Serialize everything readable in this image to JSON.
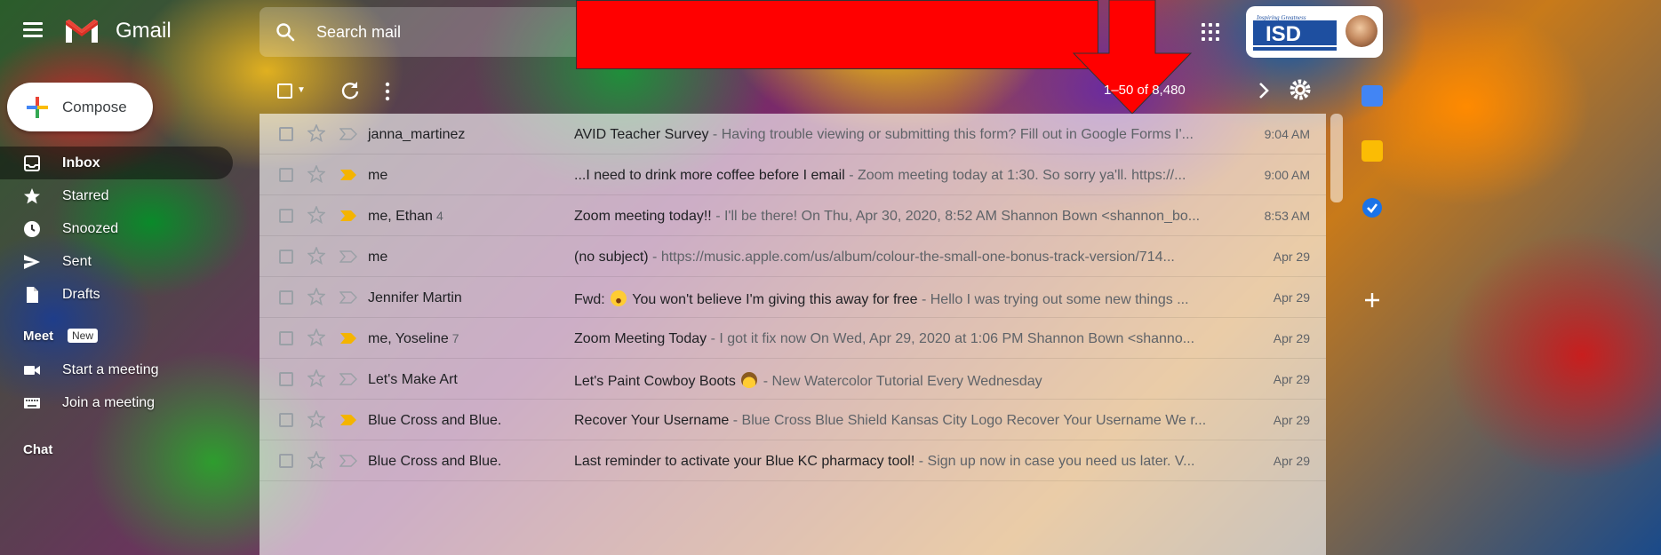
{
  "app": {
    "brand": "Gmail"
  },
  "search": {
    "placeholder": "Search mail"
  },
  "toolbar": {
    "pager": "1–50 of 8,480"
  },
  "compose": {
    "label": "Compose"
  },
  "nav": {
    "items": [
      {
        "label": "Inbox",
        "icon": "inbox-icon"
      },
      {
        "label": "Starred",
        "icon": "star-icon"
      },
      {
        "label": "Snoozed",
        "icon": "clock-icon"
      },
      {
        "label": "Sent",
        "icon": "send-icon"
      },
      {
        "label": "Drafts",
        "icon": "draft-icon"
      }
    ]
  },
  "meet": {
    "header": "Meet",
    "badge": "New",
    "items": [
      {
        "label": "Start a meeting",
        "icon": "video-icon"
      },
      {
        "label": "Join a meeting",
        "icon": "keyboard-icon"
      }
    ]
  },
  "chat": {
    "header": "Chat"
  },
  "emails": [
    {
      "sender": "janna_martinez",
      "count": "",
      "subject": "AVID Teacher Survey",
      "snippet": " - Having trouble viewing or submitting this form? Fill out in Google Forms I'...",
      "time": "9:04 AM",
      "important": false
    },
    {
      "sender": "me",
      "count": "",
      "subject": "...I need to drink more coffee before I email",
      "snippet": " - Zoom meeting today at 1:30. So sorry ya'll. https://...",
      "time": "9:00 AM",
      "important": true
    },
    {
      "sender": "me, Ethan",
      "count": "4",
      "subject": "Zoom meeting today!!",
      "snippet": " - I'll be there! On Thu, Apr 30, 2020, 8:52 AM Shannon Bown <shannon_bo...",
      "time": "8:53 AM",
      "important": true
    },
    {
      "sender": "me",
      "count": "",
      "subject": "(no subject)",
      "snippet": " - https://music.apple.com/us/album/colour-the-small-one-bonus-track-version/714...",
      "time": "Apr 29",
      "important": false
    },
    {
      "sender": "Jennifer Martin",
      "count": "",
      "subject_pre": "Fwd: ",
      "subject": "You won't believe I'm giving this away for free",
      "snippet": " - Hello I was trying out some new things ...",
      "time": "Apr 29",
      "important": false,
      "emoji": "surprised-face-emoji"
    },
    {
      "sender": "me, Yoseline",
      "count": "7",
      "subject": "Zoom Meeting Today",
      "snippet": " - I got it fix now On Wed, Apr 29, 2020 at 1:06 PM Shannon Bown <shanno...",
      "time": "Apr 29",
      "important": true
    },
    {
      "sender": "Let's Make Art",
      "count": "",
      "subject": "Let's Paint Cowboy Boots",
      "snippet": " - New Watercolor Tutorial Every Wednesday",
      "time": "Apr 29",
      "important": false,
      "emoji_after": "cowboy-face-emoji"
    },
    {
      "sender": "Blue Cross and Blue.",
      "count": "",
      "subject": "Recover Your Username",
      "snippet": " - Blue Cross Blue Shield Kansas City Logo Recover Your Username We r...",
      "time": "Apr 29",
      "important": true
    },
    {
      "sender": "Blue Cross and Blue.",
      "count": "",
      "subject": "Last reminder to activate your Blue KC pharmacy tool!",
      "snippet": " - Sign up now in case you need us later. V...",
      "time": "Apr 29",
      "important": false
    }
  ],
  "colors": {
    "red_banner": "#ff0000",
    "important_marker": "#f4b400",
    "calendar": "#4285f4",
    "keep": "#fbbc04",
    "tasks": "#1a73e8"
  }
}
